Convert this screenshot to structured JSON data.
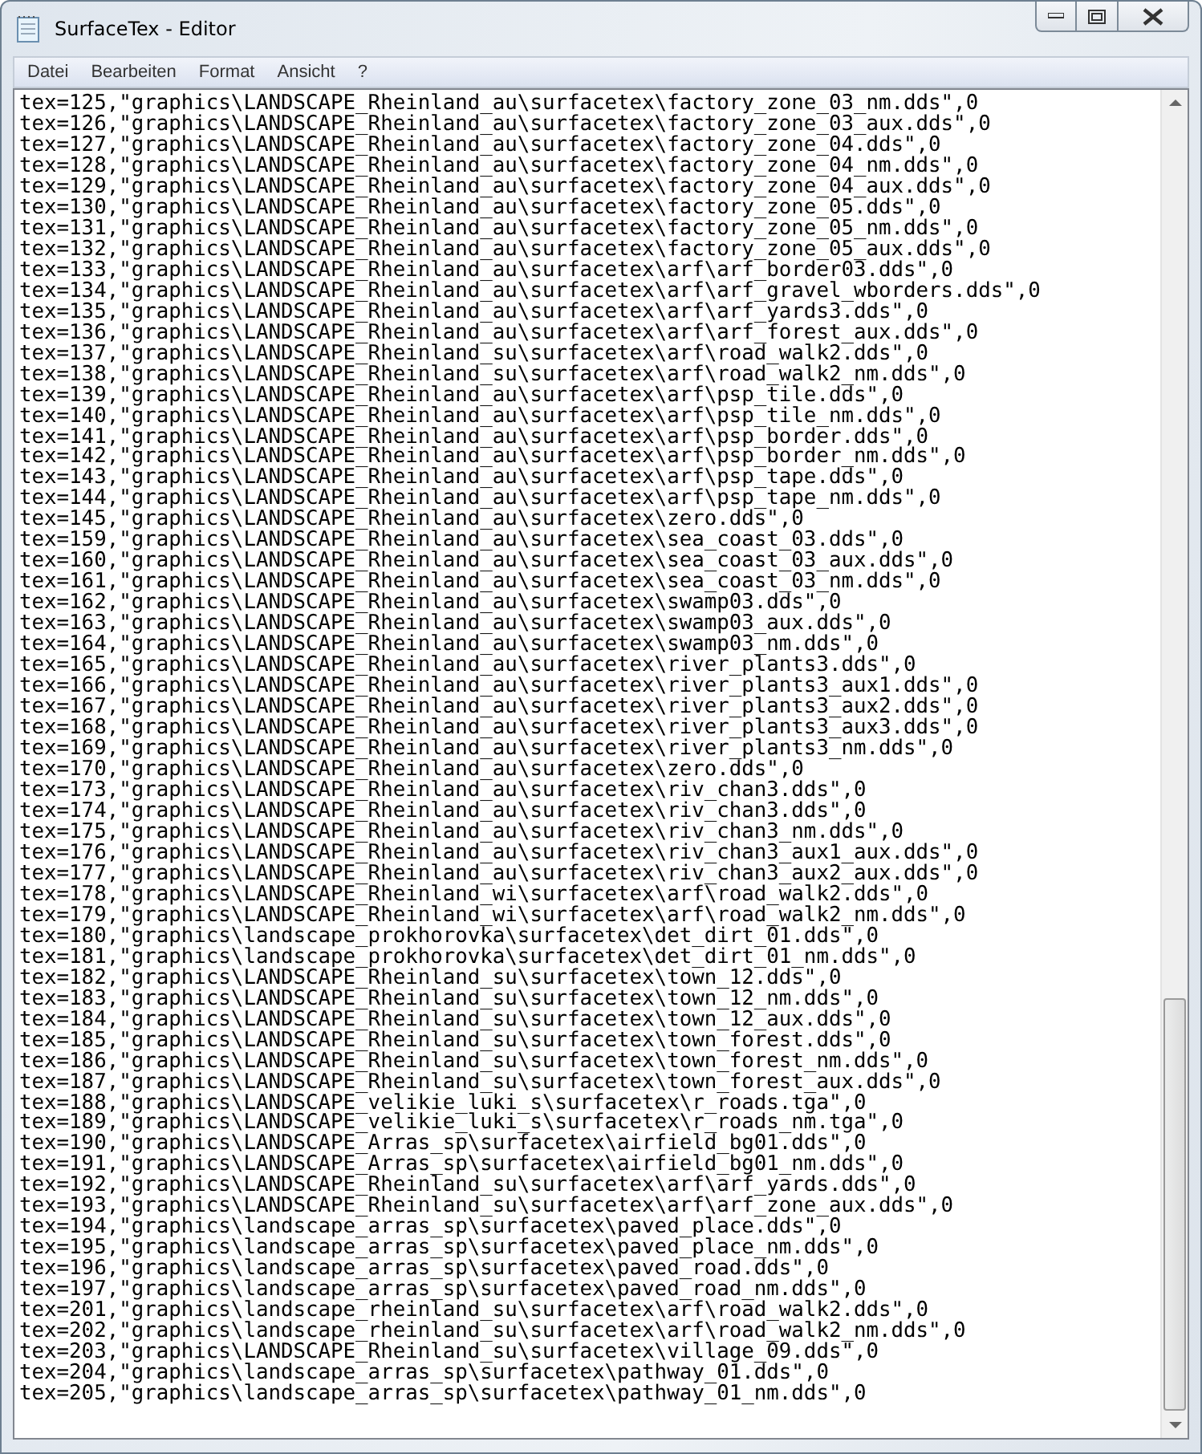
{
  "window": {
    "title": "SurfaceTex - Editor"
  },
  "menu": [
    "Datei",
    "Bearbeiten",
    "Format",
    "Ansicht",
    "?"
  ],
  "lines": [
    "tex=125,\"graphics\\LANDSCAPE_Rheinland_au\\surfacetex\\factory_zone_03_nm.dds\",0",
    "tex=126,\"graphics\\LANDSCAPE_Rheinland_au\\surfacetex\\factory_zone_03_aux.dds\",0",
    "tex=127,\"graphics\\LANDSCAPE_Rheinland_au\\surfacetex\\factory_zone_04.dds\",0",
    "tex=128,\"graphics\\LANDSCAPE_Rheinland_au\\surfacetex\\factory_zone_04_nm.dds\",0",
    "tex=129,\"graphics\\LANDSCAPE_Rheinland_au\\surfacetex\\factory_zone_04_aux.dds\",0",
    "tex=130,\"graphics\\LANDSCAPE_Rheinland_au\\surfacetex\\factory_zone_05.dds\",0",
    "tex=131,\"graphics\\LANDSCAPE_Rheinland_au\\surfacetex\\factory_zone_05_nm.dds\",0",
    "tex=132,\"graphics\\LANDSCAPE_Rheinland_au\\surfacetex\\factory_zone_05_aux.dds\",0",
    "tex=133,\"graphics\\LANDSCAPE_Rheinland_au\\surfacetex\\arf\\arf_border03.dds\",0",
    "tex=134,\"graphics\\LANDSCAPE_Rheinland_au\\surfacetex\\arf\\arf_gravel_wborders.dds\",0",
    "tex=135,\"graphics\\LANDSCAPE_Rheinland_au\\surfacetex\\arf\\arf_yards3.dds\",0",
    "tex=136,\"graphics\\LANDSCAPE_Rheinland_au\\surfacetex\\arf\\arf_forest_aux.dds\",0",
    "tex=137,\"graphics\\LANDSCAPE_Rheinland_su\\surfacetex\\arf\\road_walk2.dds\",0",
    "tex=138,\"graphics\\LANDSCAPE_Rheinland_su\\surfacetex\\arf\\road_walk2_nm.dds\",0",
    "tex=139,\"graphics\\LANDSCAPE_Rheinland_au\\surfacetex\\arf\\psp_tile.dds\",0",
    "tex=140,\"graphics\\LANDSCAPE_Rheinland_au\\surfacetex\\arf\\psp_tile_nm.dds\",0",
    "tex=141,\"graphics\\LANDSCAPE_Rheinland_au\\surfacetex\\arf\\psp_border.dds\",0",
    "tex=142,\"graphics\\LANDSCAPE_Rheinland_au\\surfacetex\\arf\\psp_border_nm.dds\",0",
    "tex=143,\"graphics\\LANDSCAPE_Rheinland_au\\surfacetex\\arf\\psp_tape.dds\",0",
    "tex=144,\"graphics\\LANDSCAPE_Rheinland_au\\surfacetex\\arf\\psp_tape_nm.dds\",0",
    "tex=145,\"graphics\\LANDSCAPE_Rheinland_au\\surfacetex\\zero.dds\",0",
    "tex=159,\"graphics\\LANDSCAPE_Rheinland_au\\surfacetex\\sea_coast_03.dds\",0",
    "tex=160,\"graphics\\LANDSCAPE_Rheinland_au\\surfacetex\\sea_coast_03_aux.dds\",0",
    "tex=161,\"graphics\\LANDSCAPE_Rheinland_au\\surfacetex\\sea_coast_03_nm.dds\",0",
    "tex=162,\"graphics\\LANDSCAPE_Rheinland_au\\surfacetex\\swamp03.dds\",0",
    "tex=163,\"graphics\\LANDSCAPE_Rheinland_au\\surfacetex\\swamp03_aux.dds\",0",
    "tex=164,\"graphics\\LANDSCAPE_Rheinland_au\\surfacetex\\swamp03_nm.dds\",0",
    "tex=165,\"graphics\\LANDSCAPE_Rheinland_au\\surfacetex\\river_plants3.dds\",0",
    "tex=166,\"graphics\\LANDSCAPE_Rheinland_au\\surfacetex\\river_plants3_aux1.dds\",0",
    "tex=167,\"graphics\\LANDSCAPE_Rheinland_au\\surfacetex\\river_plants3_aux2.dds\",0",
    "tex=168,\"graphics\\LANDSCAPE_Rheinland_au\\surfacetex\\river_plants3_aux3.dds\",0",
    "tex=169,\"graphics\\LANDSCAPE_Rheinland_au\\surfacetex\\river_plants3_nm.dds\",0",
    "tex=170,\"graphics\\LANDSCAPE_Rheinland_au\\surfacetex\\zero.dds\",0",
    "tex=173,\"graphics\\LANDSCAPE_Rheinland_au\\surfacetex\\riv_chan3.dds\",0",
    "tex=174,\"graphics\\LANDSCAPE_Rheinland_au\\surfacetex\\riv_chan3.dds\",0",
    "tex=175,\"graphics\\LANDSCAPE_Rheinland_au\\surfacetex\\riv_chan3_nm.dds\",0",
    "tex=176,\"graphics\\LANDSCAPE_Rheinland_au\\surfacetex\\riv_chan3_aux1_aux.dds\",0",
    "tex=177,\"graphics\\LANDSCAPE_Rheinland_au\\surfacetex\\riv_chan3_aux2_aux.dds\",0",
    "tex=178,\"graphics\\LANDSCAPE_Rheinland_wi\\surfacetex\\arf\\road_walk2.dds\",0",
    "tex=179,\"graphics\\LANDSCAPE_Rheinland_wi\\surfacetex\\arf\\road_walk2_nm.dds\",0",
    "tex=180,\"graphics\\landscape_prokhorovka\\surfacetex\\det_dirt_01.dds\",0",
    "tex=181,\"graphics\\landscape_prokhorovka\\surfacetex\\det_dirt_01_nm.dds\",0",
    "tex=182,\"graphics\\LANDSCAPE_Rheinland_su\\surfacetex\\town_12.dds\",0",
    "tex=183,\"graphics\\LANDSCAPE_Rheinland_su\\surfacetex\\town_12_nm.dds\",0",
    "tex=184,\"graphics\\LANDSCAPE_Rheinland_su\\surfacetex\\town_12_aux.dds\",0",
    "tex=185,\"graphics\\LANDSCAPE_Rheinland_su\\surfacetex\\town_forest.dds\",0",
    "tex=186,\"graphics\\LANDSCAPE_Rheinland_su\\surfacetex\\town_forest_nm.dds\",0",
    "tex=187,\"graphics\\LANDSCAPE_Rheinland_su\\surfacetex\\town_forest_aux.dds\",0",
    "tex=188,\"graphics\\LANDSCAPE_velikie_luki_s\\surfacetex\\r_roads.tga\",0",
    "tex=189,\"graphics\\LANDSCAPE_velikie_luki_s\\surfacetex\\r_roads_nm.tga\",0",
    "tex=190,\"graphics\\LANDSCAPE_Arras_sp\\surfacetex\\airfield_bg01.dds\",0",
    "tex=191,\"graphics\\LANDSCAPE_Arras_sp\\surfacetex\\airfield_bg01_nm.dds\",0",
    "tex=192,\"graphics\\LANDSCAPE_Rheinland_su\\surfacetex\\arf\\arf_yards.dds\",0",
    "tex=193,\"graphics\\LANDSCAPE_Rheinland_su\\surfacetex\\arf\\arf_zone_aux.dds\",0",
    "tex=194,\"graphics\\landscape_arras_sp\\surfacetex\\paved_place.dds\",0",
    "tex=195,\"graphics\\landscape_arras_sp\\surfacetex\\paved_place_nm.dds\",0",
    "tex=196,\"graphics\\landscape_arras_sp\\surfacetex\\paved_road.dds\",0",
    "tex=197,\"graphics\\landscape_arras_sp\\surfacetex\\paved_road_nm.dds\",0",
    "tex=201,\"graphics\\landscape_rheinland_su\\surfacetex\\arf\\road_walk2.dds\",0",
    "tex=202,\"graphics\\landscape_rheinland_su\\surfacetex\\arf\\road_walk2_nm.dds\",0",
    "tex=203,\"graphics\\LANDSCAPE_Rheinland_su\\surfacetex\\village_09.dds\",0",
    "tex=204,\"graphics\\landscape_arras_sp\\surfacetex\\pathway_01.dds\",0",
    "tex=205,\"graphics\\landscape_arras_sp\\surfacetex\\pathway_01_nm.dds\",0"
  ]
}
